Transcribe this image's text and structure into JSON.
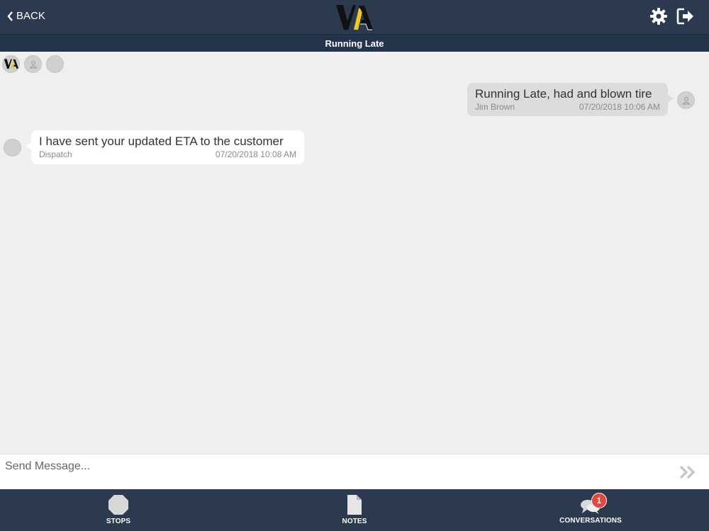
{
  "header": {
    "back_label": "BACK",
    "conversation_title": "Running Late"
  },
  "messages": [
    {
      "direction": "outgoing",
      "text": "Running Late, had and blown tire",
      "sender": "Jim Brown",
      "timestamp": "07/20/2018 10:06 AM"
    },
    {
      "direction": "incoming",
      "text": "I have sent your updated ETA to the customer",
      "sender": "Dispatch",
      "timestamp": "07/20/2018 10:08 AM"
    }
  ],
  "composer": {
    "placeholder": "Send Message..."
  },
  "tabs": [
    {
      "label": "STOPS",
      "icon": "octagon-icon"
    },
    {
      "label": "NOTES",
      "icon": "document-icon"
    },
    {
      "label": "CONVERSATIONS",
      "icon": "chat-bubbles-icon",
      "badge": "1"
    }
  ],
  "colors": {
    "header_bg": "#2b3a4f",
    "badge": "#e8453c",
    "logo_yellow": "#f2c81e"
  }
}
